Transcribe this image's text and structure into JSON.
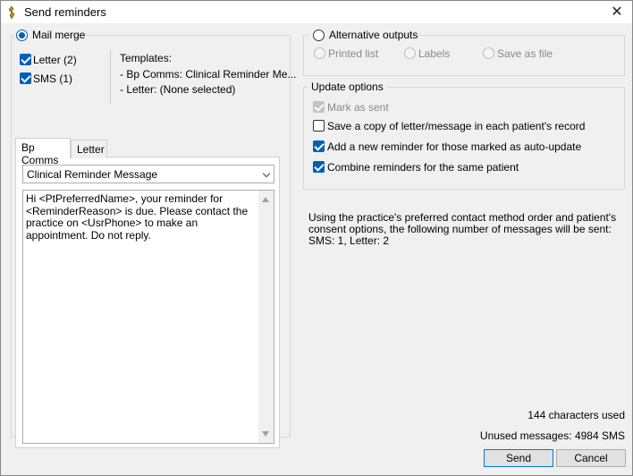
{
  "window": {
    "title": "Send reminders"
  },
  "mail_merge": {
    "label": "Mail merge",
    "letter_label": "Letter (2)",
    "sms_label": "SMS  (1)",
    "templates_heading": "Templates:",
    "template_bp": "- Bp Comms: Clinical Reminder Me...",
    "template_letter": "- Letter: (None selected)"
  },
  "alternative_outputs": {
    "label": "Alternative outputs",
    "printed_list": "Printed list",
    "labels": "Labels",
    "save_as_file": "Save as file"
  },
  "update_options": {
    "legend": "Update options",
    "mark_as_sent": "Mark as sent",
    "save_copy": "Save a copy of letter/message in each patient's record",
    "add_reminder": "Add a new reminder for those marked as auto-update",
    "combine": "Combine reminders for the same patient"
  },
  "info": {
    "line1": "Using the practice's preferred contact method order and patient's",
    "line2": "consent options, the following number of messages will be sent:",
    "line3": "SMS: 1, Letter: 2"
  },
  "tabs": {
    "bp_comms": "Bp Comms",
    "letter": "Letter"
  },
  "template_select": {
    "value": "Clinical Reminder Message"
  },
  "message": {
    "body": "Hi <PtPreferredName>, your reminder for <ReminderReason> is due. Please contact the practice on <UsrPhone> to make an appointment. Do not reply."
  },
  "status": {
    "characters_used": "144 characters used",
    "unused_messages": "Unused messages: 4984 SMS"
  },
  "buttons": {
    "send": "Send",
    "cancel": "Cancel"
  },
  "colors": {
    "accent": "#005fb8",
    "disabled": "#8a8a8a"
  }
}
